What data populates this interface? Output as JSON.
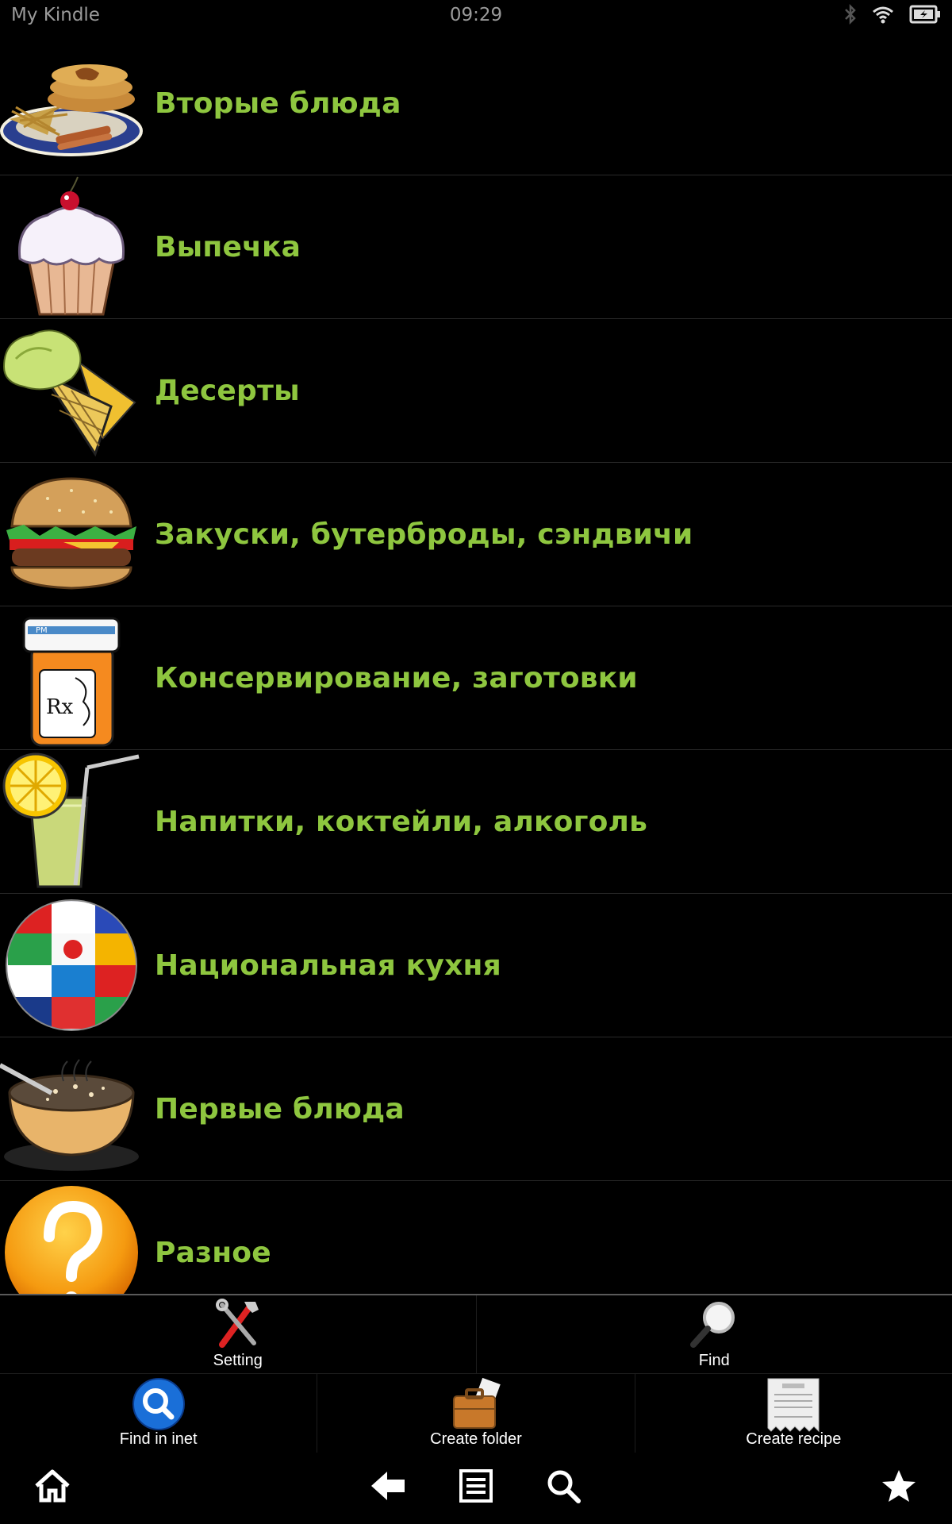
{
  "status_bar": {
    "device_name": "My Kindle",
    "time": "09:29",
    "icons": [
      "bluetooth-icon",
      "wifi-icon",
      "battery-charging-icon"
    ]
  },
  "categories": [
    {
      "label": "Вторые блюда",
      "icon": "main-dish-icon"
    },
    {
      "label": "Выпечка",
      "icon": "cupcake-icon"
    },
    {
      "label": "Десерты",
      "icon": "ice-cream-icon"
    },
    {
      "label": "Закуски, бутерброды, сэндвичи",
      "icon": "burger-icon"
    },
    {
      "label": "Консервирование, заготовки",
      "icon": "jar-icon"
    },
    {
      "label": "Напитки, коктейли, алкоголь",
      "icon": "lemonade-icon"
    },
    {
      "label": "Национальная кухня",
      "icon": "flag-globe-icon"
    },
    {
      "label": "Первые блюда",
      "icon": "soup-pot-icon"
    },
    {
      "label": "Разное",
      "icon": "question-icon"
    }
  ],
  "toolbar": {
    "setting_label": "Setting",
    "find_label": "Find",
    "find_inet_label": "Find in inet",
    "create_folder_label": "Create folder",
    "create_recipe_label": "Create recipe"
  },
  "colors": {
    "category_text": "#8ec63f",
    "background": "#000000"
  },
  "nav": [
    "home-icon",
    "back-icon",
    "menu-icon",
    "search-icon",
    "favorites-icon"
  ]
}
